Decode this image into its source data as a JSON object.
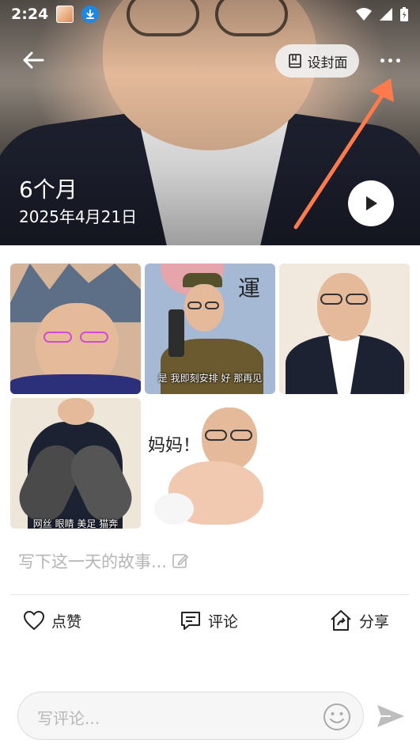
{
  "status_bar": {
    "time": "2:24"
  },
  "header": {
    "set_cover_label": "设封面",
    "title": "6个月",
    "date": "2025年4月21日"
  },
  "photos": [
    {
      "caption": ""
    },
    {
      "caption": "是 我即刻安排 好 那再见",
      "sign": "運"
    },
    {
      "caption": ""
    },
    {
      "caption": "网丝 眼睛 美足 猫奔"
    },
    {
      "caption": "妈妈！"
    }
  ],
  "story": {
    "placeholder": "写下这一天的故事..."
  },
  "actions": {
    "like_label": "点赞",
    "comment_label": "评论",
    "share_label": "分享"
  },
  "comment": {
    "placeholder": "写评论..."
  },
  "colors": {
    "annotation_arrow": "#ff7a4d",
    "accent": "#222222"
  }
}
